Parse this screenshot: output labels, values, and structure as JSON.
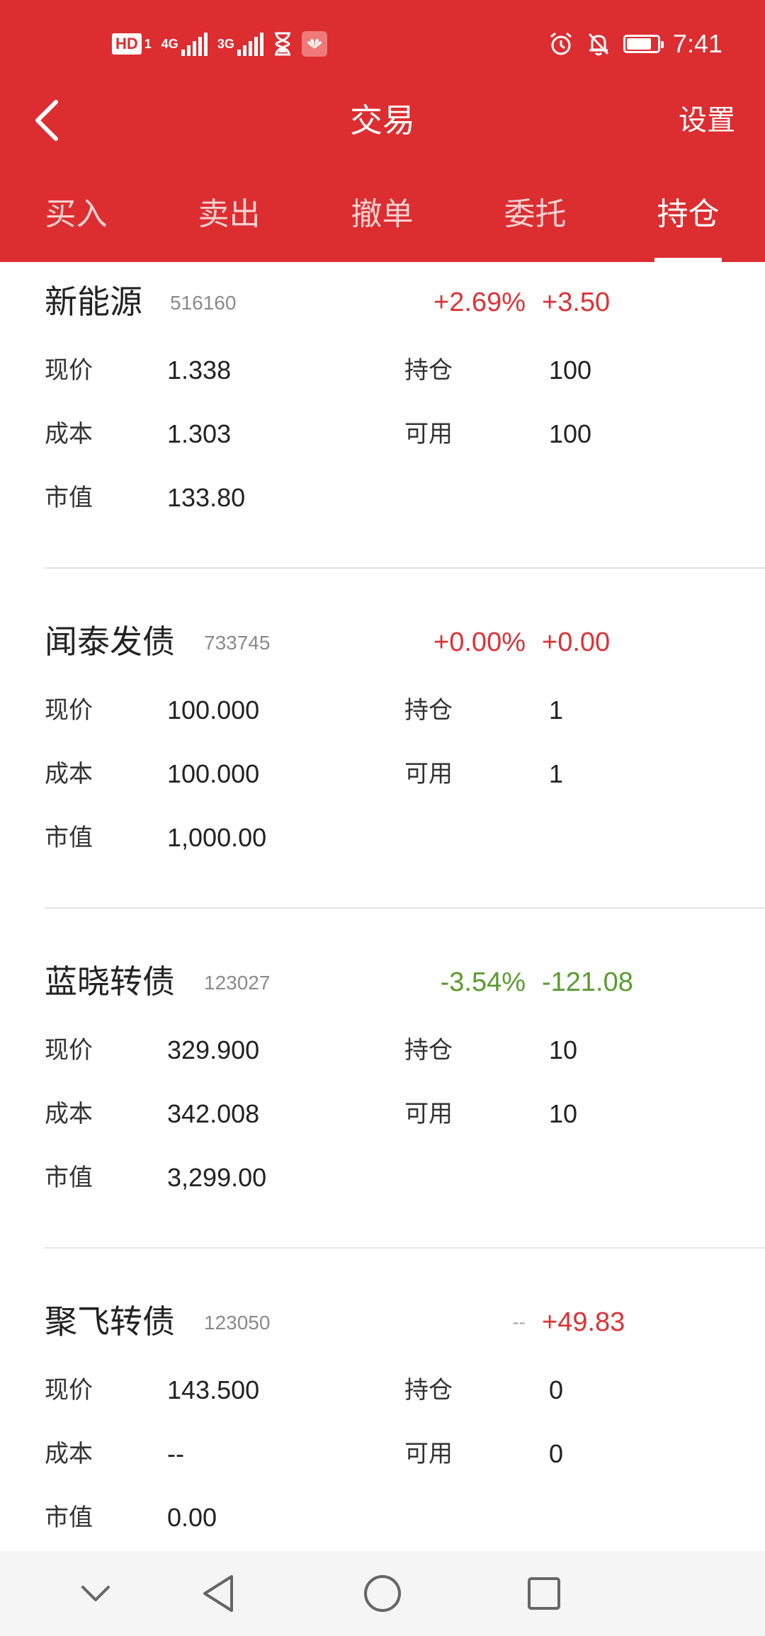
{
  "status_bar": {
    "hd": "HD",
    "sim1": "1",
    "net1": "4G",
    "net2": "3G",
    "time": "7:41"
  },
  "header": {
    "title": "交易",
    "settings_label": "设置"
  },
  "tabs": [
    {
      "label": "买入"
    },
    {
      "label": "卖出"
    },
    {
      "label": "撤单"
    },
    {
      "label": "委托"
    },
    {
      "label": "持仓"
    }
  ],
  "positions": [
    {
      "name": "新能源",
      "code": "516160",
      "change_pct": "+2.69%",
      "profit": "+3.50",
      "current_price_label": "现价",
      "current_price": "1.338",
      "holding_label": "持仓",
      "holding": "100",
      "cost_label": "成本",
      "cost": "1.303",
      "available_label": "可用",
      "available": "100",
      "market_value_label": "市值",
      "market_value": "133.80"
    },
    {
      "name": "闻泰发债",
      "code": "733745",
      "change_pct": "+0.00%",
      "profit": "+0.00",
      "current_price_label": "现价",
      "current_price": "100.000",
      "holding_label": "持仓",
      "holding": "1",
      "cost_label": "成本",
      "cost": "100.000",
      "available_label": "可用",
      "available": "1",
      "market_value_label": "市值",
      "market_value": "1,000.00"
    },
    {
      "name": "蓝晓转债",
      "code": "123027",
      "change_pct": "-3.54%",
      "profit": "-121.08",
      "current_price_label": "现价",
      "current_price": "329.900",
      "holding_label": "持仓",
      "holding": "10",
      "cost_label": "成本",
      "cost": "342.008",
      "available_label": "可用",
      "available": "10",
      "market_value_label": "市值",
      "market_value": "3,299.00"
    },
    {
      "name": "聚飞转债",
      "code": "123050",
      "change_pct": "--",
      "profit": "+49.83",
      "current_price_label": "现价",
      "current_price": "143.500",
      "holding_label": "持仓",
      "holding": "0",
      "cost_label": "成本",
      "cost": "--",
      "available_label": "可用",
      "available": "0",
      "market_value_label": "市值",
      "market_value": "0.00"
    }
  ],
  "colors": {
    "header_bg": "#dc2d30",
    "rise": "#dd3236",
    "fall": "#5a9b2f",
    "neutral": "#a7a7a7"
  }
}
